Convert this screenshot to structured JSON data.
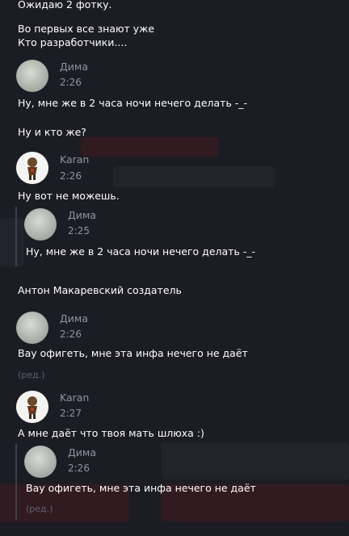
{
  "messages": {
    "m1": {
      "text": "Ожидаю 2 фотку."
    },
    "m2": {
      "line1": "Во первых все знают уже",
      "line2": "Кто разработчики...."
    },
    "m3": {
      "author": "Дима",
      "time": "2:26",
      "text": "Ну, мне же в 2 часа ночи нечего делать -_-"
    },
    "m4": {
      "text": "Ну и кто же?"
    },
    "m5": {
      "author": "Karan",
      "time": "2:26",
      "text": "Ну вот не можешь.",
      "quote": {
        "author": "Дима",
        "time": "2:25",
        "text": "Ну, мне же в 2 часа ночи нечего делать -_-"
      }
    },
    "m6": {
      "text": "Антон Макаревский создатель"
    },
    "m7": {
      "author": "Дима",
      "time": "2:26",
      "text": "Вау офигеть, мне эта инфа нечего не даёт",
      "edited": "(ред.)"
    },
    "m8": {
      "author": "Karan",
      "time": "2:27",
      "text": "А мне даёт что твоя мать шлюха :)",
      "quote": {
        "author": "Дима",
        "time": "2:26",
        "text": "Вау офигеть, мне эта инфа нечего не даёт",
        "edited": "(ред.)"
      }
    }
  },
  "colors": {
    "background": "#1c1d24",
    "text": "#ffffff",
    "meta": "#8f93a3",
    "edited": "#5d6070"
  }
}
